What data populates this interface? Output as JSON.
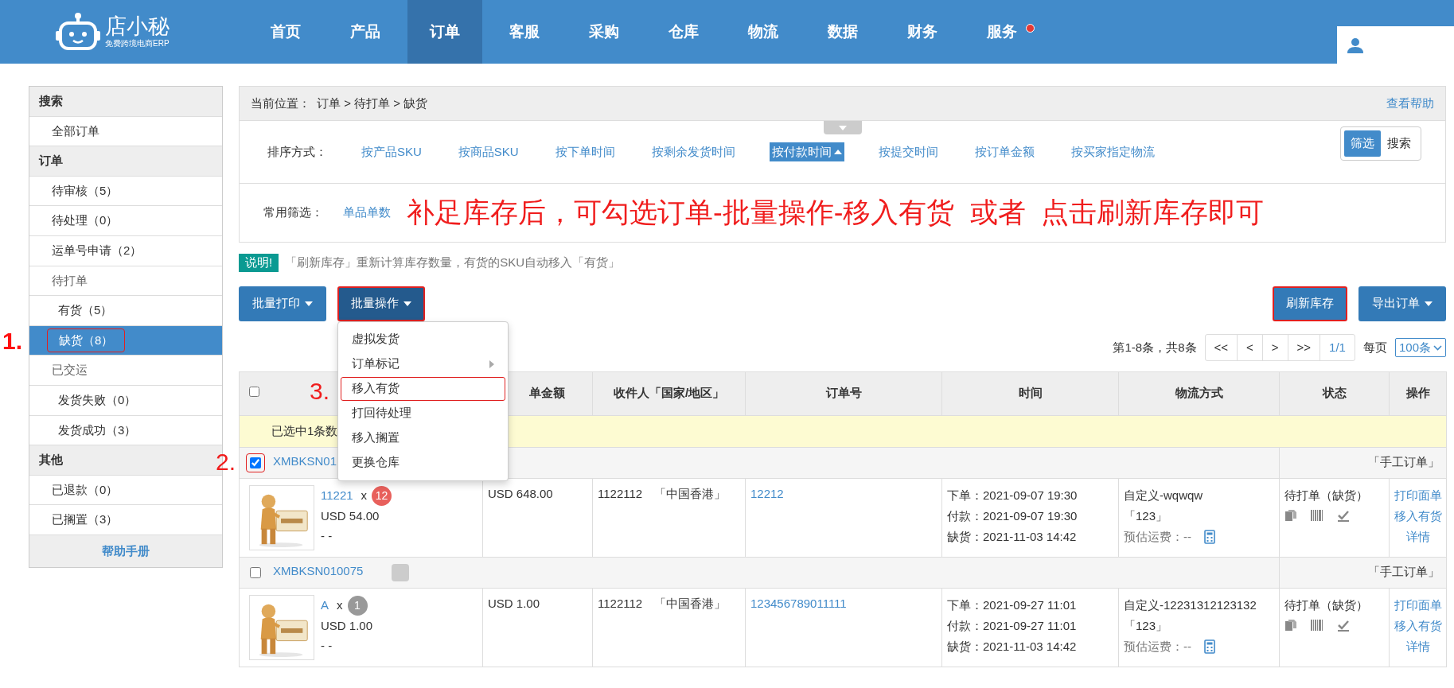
{
  "logo": {
    "name": "店小秘",
    "tagline": "免费跨境电商ERP"
  },
  "nav": [
    {
      "label": "首页",
      "selected": false,
      "notification": false
    },
    {
      "label": "产品",
      "selected": false,
      "notification": false
    },
    {
      "label": "订单",
      "selected": true,
      "notification": false
    },
    {
      "label": "客服",
      "selected": false,
      "notification": false
    },
    {
      "label": "采购",
      "selected": false,
      "notification": false
    },
    {
      "label": "仓库",
      "selected": false,
      "notification": false
    },
    {
      "label": "物流",
      "selected": false,
      "notification": false
    },
    {
      "label": "数据",
      "selected": false,
      "notification": false
    },
    {
      "label": "财务",
      "selected": false,
      "notification": false
    },
    {
      "label": "服务",
      "selected": false,
      "notification": true
    }
  ],
  "sidebar": {
    "groups": [
      {
        "title": "搜索",
        "items": [
          {
            "label": "全部订单",
            "selected": false
          }
        ]
      },
      {
        "title": "订单",
        "items": [
          {
            "label": "待审核（5）",
            "selected": false
          },
          {
            "label": "待处理（0）",
            "selected": false
          },
          {
            "label": "运单号申请（2）",
            "selected": false
          },
          {
            "label": "待打单",
            "selected": false,
            "children": [
              {
                "label": "有货（5）",
                "selected": false
              },
              {
                "label": "缺货（8）",
                "selected": true,
                "highlighted": true,
                "annotation": "1."
              }
            ]
          },
          {
            "label": "已交运",
            "selected": false,
            "children": [
              {
                "label": "发货失败（0）",
                "selected": false
              },
              {
                "label": "发货成功（3）",
                "selected": false
              }
            ]
          }
        ]
      },
      {
        "title": "其他",
        "items": [
          {
            "label": "已退款（0）",
            "selected": false
          },
          {
            "label": "已搁置（3）",
            "selected": false
          }
        ]
      }
    ],
    "help_link": "帮助手册"
  },
  "breadcrumb": {
    "label": "当前位置：",
    "path": "订单 > 待打单 > 缺货",
    "help": "查看帮助"
  },
  "sort": {
    "label": "排序方式：",
    "options": [
      {
        "label": "按产品SKU",
        "selected": false
      },
      {
        "label": "按商品SKU",
        "selected": false
      },
      {
        "label": "按下单时间",
        "selected": false
      },
      {
        "label": "按剩余发货时间",
        "selected": false
      },
      {
        "label": "按付款时间",
        "selected": true
      },
      {
        "label": "按提交时间",
        "selected": false
      },
      {
        "label": "按订单金额",
        "selected": false
      },
      {
        "label": "按买家指定物流",
        "selected": false
      }
    ]
  },
  "view_toggle": [
    {
      "label": "筛选",
      "selected": true
    },
    {
      "label": "搜索",
      "selected": false
    }
  ],
  "filter": {
    "label": "常用筛选：",
    "options": [
      "单品单数"
    ],
    "instruction": "补足库存后，可勾选订单-批量操作-移入有货  或者  点击刷新库存即可"
  },
  "notice": {
    "badge": "说明!",
    "text": "「刷新库存」重新计算库存数量，有货的SKU自动移入「有货」"
  },
  "toolbar": {
    "left": [
      {
        "label": "批量打印",
        "dropdown": true,
        "active": false,
        "highlighted": false
      },
      {
        "label": "批量操作",
        "dropdown": true,
        "active": true,
        "highlighted": true
      }
    ],
    "right": [
      {
        "label": "刷新库存",
        "dropdown": false,
        "active": false,
        "highlighted": true
      },
      {
        "label": "导出订单",
        "dropdown": true,
        "active": false,
        "highlighted": false
      }
    ]
  },
  "bulk_menu": [
    {
      "label": "虚拟发货",
      "submenu": false,
      "highlighted": false
    },
    {
      "label": "订单标记",
      "submenu": true,
      "highlighted": false
    },
    {
      "label": "移入有货",
      "submenu": false,
      "highlighted": true,
      "annotation": "3."
    },
    {
      "label": "打回待处理",
      "submenu": false,
      "highlighted": false
    },
    {
      "label": "移入搁置",
      "submenu": false,
      "highlighted": false
    },
    {
      "label": "更换仓库",
      "submenu": false,
      "highlighted": false
    }
  ],
  "pager": {
    "summary": "第1-8条，共8条",
    "buttons": [
      "<<",
      "<",
      ">",
      ">>"
    ],
    "page": "1/1",
    "per_page_label": "每页",
    "per_page": "100条"
  },
  "table": {
    "select_all": {
      "checked": false
    },
    "columns": [
      "单金额",
      "收件人「国家/地区」",
      "订单号",
      "时间",
      "物流方式",
      "状态",
      "操作"
    ],
    "selection_note": "已选中1条数",
    "orders": [
      {
        "id": "XMBKSN01",
        "checked": true,
        "highlighted": true,
        "annotation": "2.",
        "tag": false,
        "source": "「手工订单」",
        "item": {
          "sku": "11221",
          "times": "x",
          "qty": "12",
          "color": "#e8605c",
          "price": "USD 54.00",
          "note": "- -"
        },
        "amount": "USD 648.00",
        "recipient": "1122112　「中国香港」",
        "order_no": "12212",
        "times": [
          "下单：2021-09-07 19:30",
          "付款：2021-09-07 19:30",
          "缺货：2021-11-03 14:42"
        ],
        "logistics": {
          "method": "自定义-wqwqw",
          "code": "「123」",
          "freight": "预估运费：--"
        },
        "status": "待打单（缺货）",
        "actions": [
          "打印面单",
          "移入有货",
          "详情"
        ]
      },
      {
        "id": "XMBKSN010075",
        "checked": false,
        "highlighted": false,
        "tag": true,
        "source": "「手工订单」",
        "item": {
          "sku": "A",
          "times": "x",
          "qty": "1",
          "color": "#999999",
          "price": "USD 1.00",
          "note": "- -"
        },
        "amount": "USD 1.00",
        "recipient": "1122112　「中国香港」",
        "order_no": "123456789011111",
        "times": [
          "下单：2021-09-27 11:01",
          "付款：2021-09-27 11:01",
          "缺货：2021-11-03 14:42"
        ],
        "logistics": {
          "method": "自定义-12231312123132",
          "code": "「123」",
          "freight": "预估运费：--"
        },
        "status": "待打单（缺货）",
        "actions": [
          "打印面单",
          "移入有货",
          "详情"
        ]
      }
    ]
  }
}
